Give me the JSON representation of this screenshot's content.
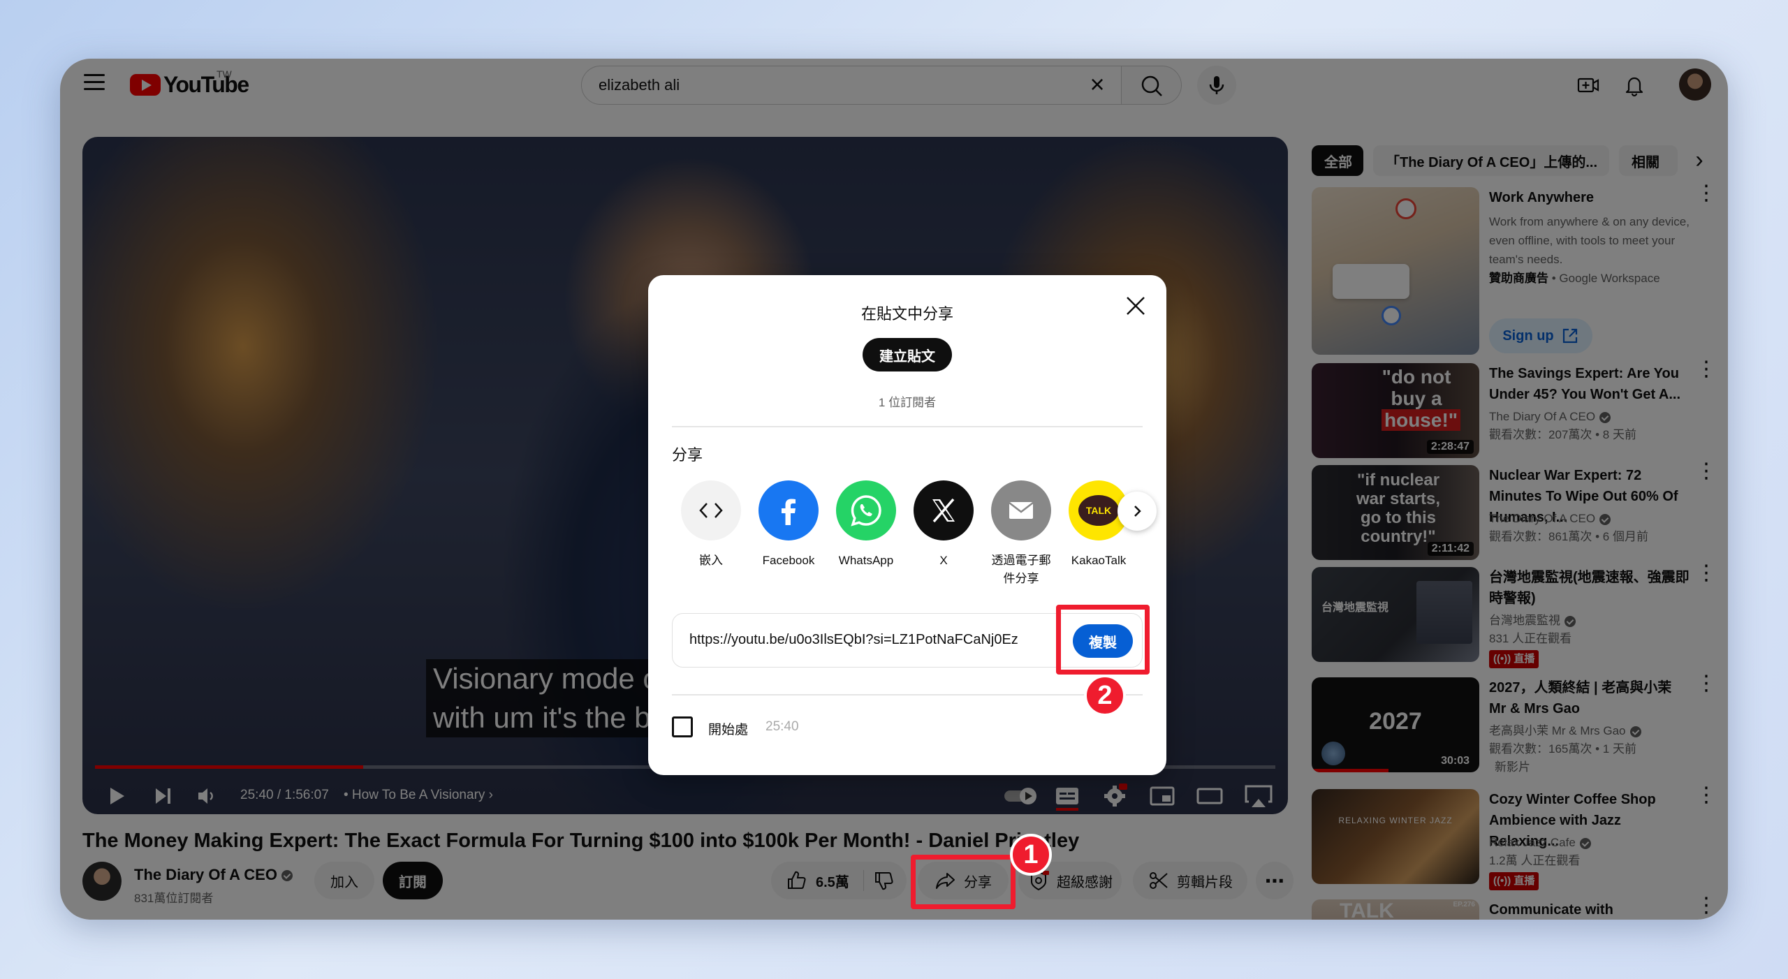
{
  "header": {
    "logo_text": "YouTube",
    "region": "TW",
    "search_value": "elizabeth ali",
    "clear_symbol": "×"
  },
  "player": {
    "caption_line1": "Visionary mode often",
    "caption_line2": "with um it's the books",
    "progress": 0.227,
    "time": "25:40 / 1:56:07",
    "chapter": "• How To Be A Visionary  ›"
  },
  "video": {
    "title": "The Money Making Expert: The Exact Formula For Turning $100 into $100k Per Month! - Daniel Priestley",
    "channel_name": "The Diary Of A CEO",
    "channel_subs": "831萬位訂閱者",
    "join_label": "加入",
    "subscribe_label": "訂閱",
    "like_count": "6.5萬",
    "share_label": "分享",
    "super_thanks_label": "超級感謝",
    "clip_label": "剪輯片段",
    "more_symbol": "⋯"
  },
  "annotations": {
    "badge1": "1",
    "badge2": "2"
  },
  "sidebar": {
    "chips": [
      "全部",
      "「The Diary Of A CEO」上傳的...",
      "相關"
    ],
    "chip_next": "›",
    "recs": [
      {
        "title": "Work Anywhere",
        "meta1": "Work from anywhere & on any device, even offline, with tools to meet your team's needs.",
        "sponsor": "贊助商廣告",
        "advertiser": "Google Workspace",
        "cta": "Sign up"
      },
      {
        "title": "The Savings Expert: Are You Under 45? You Won't Get A...",
        "channel": "The Diary Of A CEO",
        "meta": "觀看次數：207萬次 • 8 天前",
        "duration": "2:28:47",
        "thumb_text1": "\"do not",
        "thumb_text2": "buy a",
        "thumb_text3": "house!\""
      },
      {
        "title": "Nuclear War Expert: 72 Minutes To Wipe Out 60% Of Humans, I...",
        "channel": "The Diary Of A CEO",
        "meta": "觀看次數：861萬次 • 6 個月前",
        "duration": "2:11:42",
        "thumb_text1": "\"if nuclear",
        "thumb_text2": "war starts,",
        "thumb_text3": "go to this",
        "thumb_text4": "country!\""
      },
      {
        "title": "台灣地震監視(地震速報、強震即時警報)",
        "channel": "台灣地震監視",
        "meta": "831 人正在觀看",
        "live": "((•)) 直播",
        "thumb_text1": "台灣地震監視"
      },
      {
        "title": "2027，人類終結 | 老高與小茉 Mr & Mrs Gao",
        "channel": "老高與小茉 Mr & Mrs Gao",
        "meta": "觀看次數：165萬次 • 1 天前",
        "extra": "新影片",
        "duration": "30:03",
        "thumb_text1": "2027"
      },
      {
        "title": "Cozy Winter Coffee Shop Ambience with Jazz Relaxing...",
        "channel": "Relax Jazz Cafe",
        "meta": "1.2萬 人正在觀看",
        "live": "((•)) 直播",
        "thumb_text1": "RELAXING WINTER JAZZ"
      },
      {
        "title": "Communicate with Confidence:",
        "thumb_text1": "TALK",
        "thumb_tag": "EP.276"
      }
    ]
  },
  "modal": {
    "title": "在貼文中分享",
    "create_post": "建立貼文",
    "subscribers": "1 位訂閱者",
    "share_heading": "分享",
    "share_targets": [
      {
        "label": "嵌入",
        "icon": "embed-icon"
      },
      {
        "label": "Facebook",
        "icon": "facebook-icon"
      },
      {
        "label": "WhatsApp",
        "icon": "whatsapp-icon"
      },
      {
        "label": "X",
        "icon": "x-icon"
      },
      {
        "label": "透過電子郵件分享",
        "icon": "email-icon"
      },
      {
        "label": "KakaoTalk",
        "icon": "kakaotalk-icon"
      }
    ],
    "kakao_text": "TALK",
    "url": "https://youtu.be/u0o3IlsEQbI?si=LZ1PotNaFCaNj0Ez",
    "copy_label": "複製",
    "start_label": "開始處",
    "start_time": "25:40"
  },
  "colors": {
    "youtube_red": "#ff0000",
    "annotation_red": "#ef1c2e",
    "copy_blue": "#065fd4",
    "facebook": "#1877f2",
    "whatsapp": "#25d366",
    "kakao": "#fee500"
  }
}
